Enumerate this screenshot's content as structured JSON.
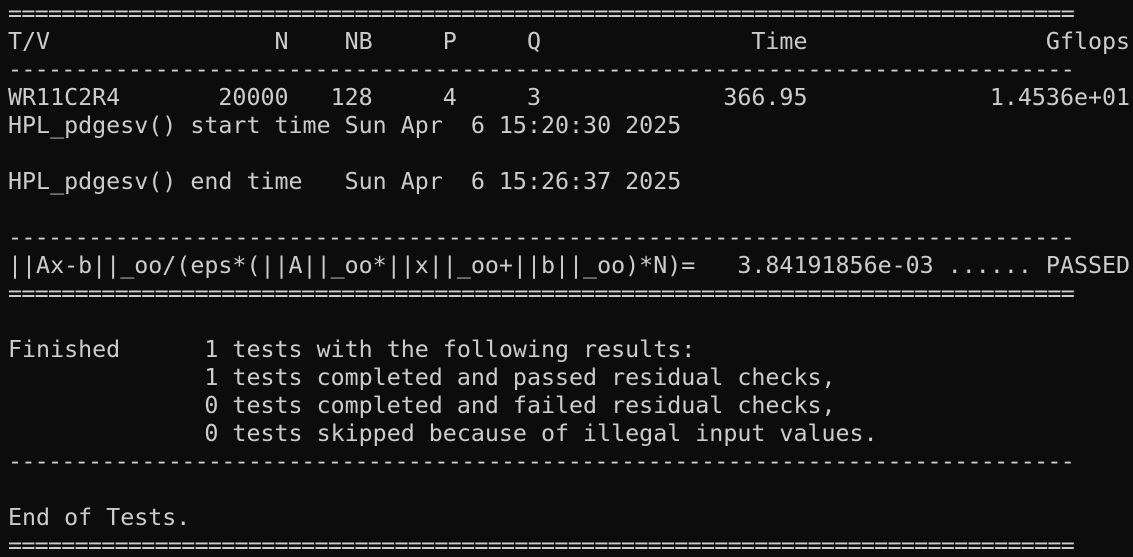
{
  "terminal": {
    "lines": [
      "================================================================================",
      "T/V                N    NB     P     Q               Time                 Gflops",
      "--------------------------------------------------------------------------------",
      "WR11C2R4       20000   128     4     3             366.95             1.4536e+01",
      "HPL_pdgesv() start time Sun Apr  6 15:20:30 2025",
      "",
      "HPL_pdgesv() end time   Sun Apr  6 15:26:37 2025",
      "",
      "--------------------------------------------------------------------------------",
      "||Ax-b||_oo/(eps*(||A||_oo*||x||_oo+||b||_oo)*N)=   3.84191856e-03 ...... PASSED",
      "================================================================================",
      "",
      "Finished      1 tests with the following results:",
      "              1 tests completed and passed residual checks,",
      "              0 tests completed and failed residual checks,",
      "              0 tests skipped because of illegal input values.",
      "--------------------------------------------------------------------------------",
      "",
      "End of Tests.",
      "================================================================================"
    ]
  },
  "colors": {
    "background": "#0c0c0c",
    "foreground": "#cccccc"
  }
}
